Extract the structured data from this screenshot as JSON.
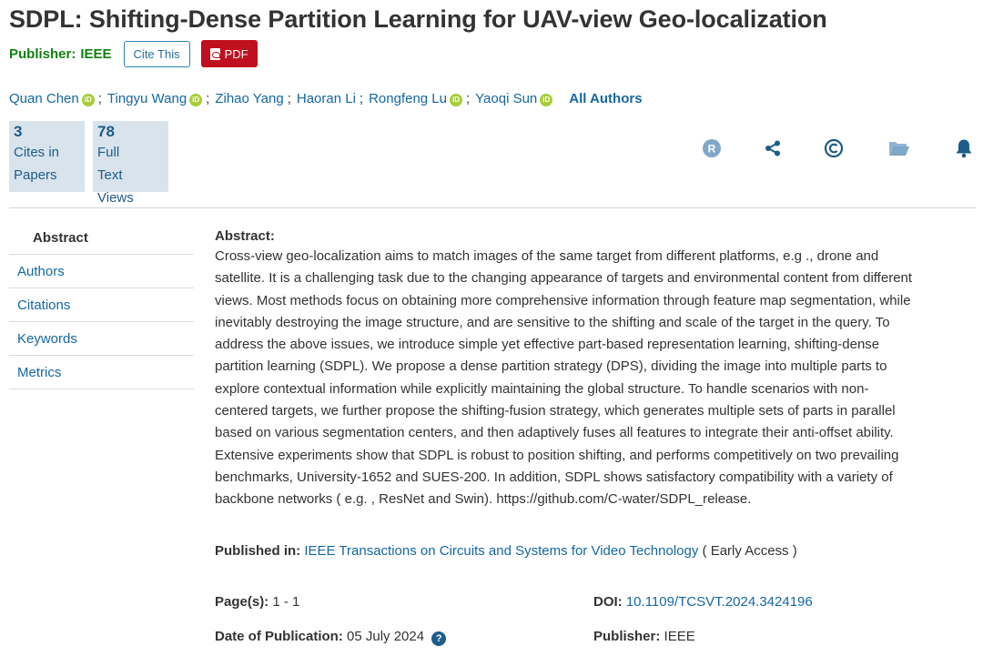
{
  "article": {
    "title": "SDPL: Shifting-Dense Partition Learning for UAV-view Geo-localization"
  },
  "publisher_bar": {
    "label": "Publisher:",
    "name": "IEEE",
    "cite_label": "Cite This",
    "pdf_label": "PDF"
  },
  "authors": [
    {
      "name": "Quan Chen",
      "orcid": true
    },
    {
      "name": "Tingyu Wang",
      "orcid": true
    },
    {
      "name": "Zihao Yang",
      "orcid": false
    },
    {
      "name": "Haoran Li",
      "orcid": false
    },
    {
      "name": "Rongfeng Lu",
      "orcid": true
    },
    {
      "name": "Yaoqi Sun",
      "orcid": true
    }
  ],
  "author_separator": ";",
  "all_authors_label": "All Authors",
  "orcid_glyph": "iD",
  "metrics": {
    "cites": {
      "value": "3",
      "line1": "Cites in",
      "line2": "Papers"
    },
    "views": {
      "value": "78",
      "line1": "Full",
      "line2": "Text",
      "line3": "Views"
    }
  },
  "action_icons": [
    "rights-icon",
    "share-icon",
    "copyright-icon",
    "folder-icon",
    "alert-bell-icon"
  ],
  "nav": {
    "items": [
      "Abstract",
      "Authors",
      "Citations",
      "Keywords",
      "Metrics"
    ]
  },
  "abstract": {
    "heading": "Abstract:",
    "lines": [
      "Cross-view geo-localization aims to match images of the same target from different platforms, e.g ., drone and",
      "satellite. It is a challenging task due to the changing appearance of targets and environmental content from different",
      "views. Most methods focus on obtaining more comprehensive information through feature map segmentation, while",
      "inevitably destroying the image structure, and are sensitive to the shifting and scale of the target in the query. To",
      "address the above issues, we introduce simple yet effective part-based representation learning, shifting-dense",
      "partition learning (SDPL). We propose a dense partition strategy (DPS), dividing the image into multiple parts to",
      "explore contextual information while explicitly maintaining the global structure. To handle scenarios with non-",
      "centered targets, we further propose the shifting-fusion strategy, which generates multiple sets of parts in parallel",
      "based on various segmentation centers, and then adaptively fuses all features to integrate their anti-offset ability.",
      "Extensive experiments show that SDPL is robust to position shifting, and performs competitively on two prevailing",
      "benchmarks, University-1652 and SUES-200. In addition, SDPL shows satisfactory compatibility with a variety of",
      "backbone networks ( e.g. , ResNet and Swin). https://github.com/C-water/SDPL_release."
    ]
  },
  "details": {
    "published_in_label": "Published in:",
    "journal": "IEEE Transactions on Circuits and Systems for Video Technology",
    "access": "( Early Access )",
    "pages_label": "Page(s):",
    "pages": "1 - 1",
    "doi_label": "DOI:",
    "doi": "10.1109/TCSVT.2024.3424196",
    "date_label": "Date of Publication:",
    "date": "05 July 2024",
    "help_glyph": "?",
    "publisher_label": "Publisher:",
    "publisher": "IEEE"
  },
  "colors": {
    "link": "#1567a1",
    "publisher_green": "#118011",
    "pdf_red": "#c00f1e",
    "metric_bg": "#d8e3ec",
    "icon_blue": "#1d5c88",
    "orcid_green": "#a6ce39"
  }
}
